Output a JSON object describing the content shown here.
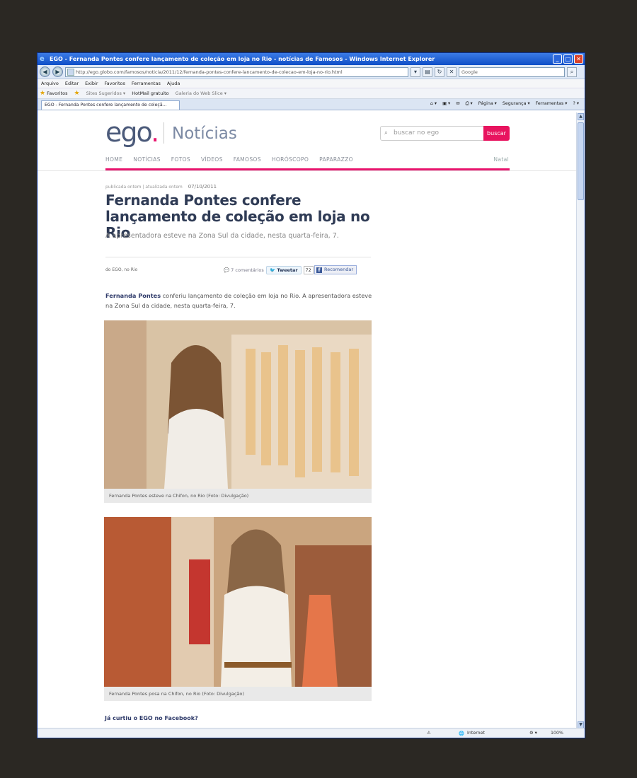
{
  "browser": {
    "title": "EGO - Fernanda Pontes confere lançamento de coleção em loja no Rio - notícias de Famosos - Windows Internet Explorer",
    "url": "http://ego.globo.com/famosos/noticia/2011/12/fernanda-pontes-confere-lancamento-de-colecao-em-loja-no-rio.html",
    "search_placeholder": "Google",
    "menu": [
      "Arquivo",
      "Editar",
      "Exibir",
      "Favoritos",
      "Ferramentas",
      "Ajuda"
    ],
    "favorites": {
      "label": "Favoritos",
      "items": [
        "Sites Sugeridos ▾",
        "HotMail gratuito",
        "Galeria do Web Slice ▾"
      ]
    },
    "tab_title": "EGO - Fernanda Pontes confere lançamento de coleçã...",
    "commands": [
      "Página ▾",
      "Segurança ▾",
      "Ferramentas ▾"
    ],
    "status": {
      "zone": "Internet",
      "zoom": "100%"
    }
  },
  "site": {
    "logo_text": "ego",
    "logo_dot": ".",
    "section": "Notícias",
    "search_placeholder": "buscar no ego",
    "search_button": "buscar",
    "nav": [
      "HOME",
      "NOTÍCIAS",
      "FOTOS",
      "VÍDEOS",
      "FAMOSOS",
      "HORÓSCOPO",
      "PAPARAZZO"
    ],
    "nav_right": "Natal",
    "accent": "#e8146d"
  },
  "article": {
    "published": "publicada ontem",
    "updated": "atualizada ontem",
    "date": "07/10/2011",
    "headline": "Fernanda Pontes confere lançamento de coleção em loja no Rio",
    "subhead": "A apresentadora esteve na Zona Sul da cidade, nesta quarta-feira, 7.",
    "byline": "do EGO, no Rio",
    "comments": "7 comentários",
    "tweet_label": "Tweetar",
    "tweet_count": "72",
    "fb_label": "Recomendar",
    "lead_name": "Fernanda Pontes",
    "lead_rest": " conferiu lançamento de coleção em loja no Rio. A apresentadora esteve na Zona Sul da cidade, nesta quarta-feira, 7.",
    "photos": [
      {
        "caption": "Fernanda Pontes esteve na Chifon, no Rio  (Foto: Divulgação)"
      },
      {
        "caption": "Fernanda Pontes posa na Chifon, no Rio  (Foto: Divulgação)"
      }
    ],
    "facebook_cta": "Já curtiu o EGO no Facebook?"
  }
}
